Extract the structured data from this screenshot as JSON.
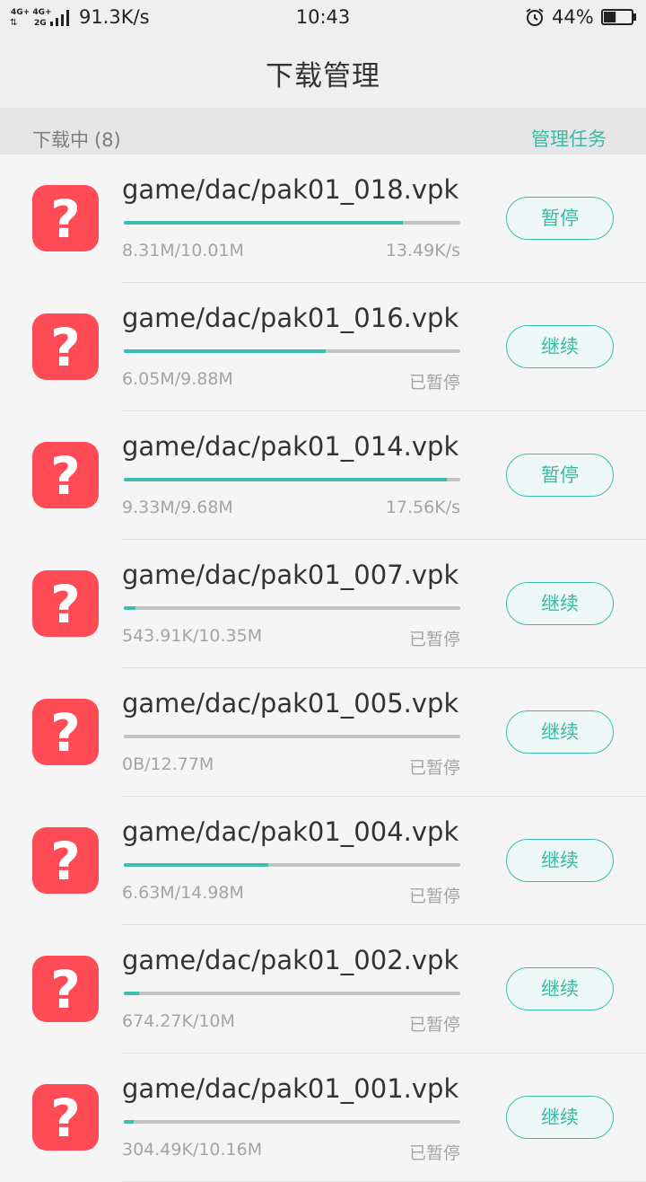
{
  "status_bar": {
    "network_top": "4G+ 4G+",
    "network_bottom": "2G",
    "speed": "91.3K/s",
    "time": "10:43",
    "battery_percent": "44%",
    "battery_level": 0.44,
    "icons": [
      "signal-icon",
      "alarm-icon",
      "battery-icon"
    ]
  },
  "header": {
    "title": "下载管理"
  },
  "section": {
    "label": "下载中",
    "count": "(8)",
    "manage_label": "管理任务"
  },
  "colors": {
    "accent": "#3cbfae",
    "app_icon": "#ff4b55",
    "track": "#c3c3c3"
  },
  "downloads": [
    {
      "name": "game/dac/pak01_018.vpk",
      "size": "8.31M/10.01M",
      "status": "13.49K/s",
      "progress": 0.83,
      "button": "暂停"
    },
    {
      "name": "game/dac/pak01_016.vpk",
      "size": "6.05M/9.88M",
      "status": "已暂停",
      "progress": 0.6,
      "button": "继续"
    },
    {
      "name": "game/dac/pak01_014.vpk",
      "size": "9.33M/9.68M",
      "status": "17.56K/s",
      "progress": 0.96,
      "button": "暂停"
    },
    {
      "name": "game/dac/pak01_007.vpk",
      "size": "543.91K/10.35M",
      "status": "已暂停",
      "progress": 0.035,
      "button": "继续"
    },
    {
      "name": "game/dac/pak01_005.vpk",
      "size": "0B/12.77M",
      "status": "已暂停",
      "progress": 0.0,
      "button": "继续"
    },
    {
      "name": "game/dac/pak01_004.vpk",
      "size": "6.63M/14.98M",
      "status": "已暂停",
      "progress": 0.43,
      "button": "继续"
    },
    {
      "name": "game/dac/pak01_002.vpk",
      "size": "674.27K/10M",
      "status": "已暂停",
      "progress": 0.045,
      "button": "继续"
    },
    {
      "name": "game/dac/pak01_001.vpk",
      "size": "304.49K/10.16M",
      "status": "已暂停",
      "progress": 0.03,
      "button": "继续"
    }
  ]
}
